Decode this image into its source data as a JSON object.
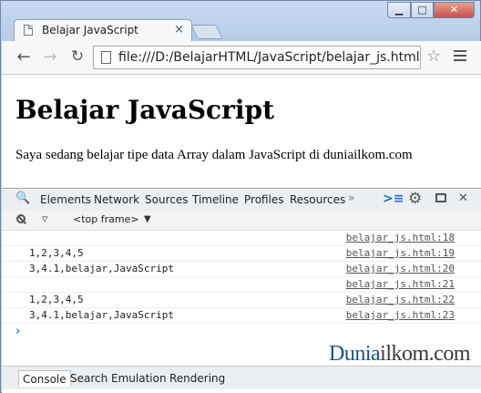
{
  "window": {
    "tab_title": "Belajar JavaScript",
    "tab_close": "×",
    "min_label": "▁",
    "max_label": "□",
    "close_label": "✕"
  },
  "toolbar": {
    "back": "←",
    "forward": "→",
    "reload": "↻",
    "url": "file:///D:/BelajarHTML/JavaScript/belajar_js.html",
    "star": "☆"
  },
  "page": {
    "heading": "Belajar JavaScript",
    "paragraph": "Saya sedang belajar tipe data Array dalam JavaScript di duniailkom.com"
  },
  "devtools": {
    "tabs": [
      "Elements",
      "Network",
      "Sources",
      "Timeline",
      "Profiles",
      "Resources"
    ],
    "more": "»",
    "frame_select": "<top frame>",
    "frame_arrow": "▼",
    "console_rows": [
      {
        "msg": "",
        "src": "belajar_js.html:18"
      },
      {
        "msg": "1,2,3,4,5",
        "src": "belajar_js.html:19"
      },
      {
        "msg": "3,4.1,belajar,JavaScript",
        "src": "belajar_js.html:20"
      },
      {
        "msg": "",
        "src": "belajar_js.html:21"
      },
      {
        "msg": "1,2,3,4,5",
        "src": "belajar_js.html:22"
      },
      {
        "msg": "3,4.1,belajar,JavaScript",
        "src": "belajar_js.html:23"
      }
    ],
    "prompt": "›",
    "drawer_tabs": [
      "Console",
      "Search",
      "Emulation",
      "Rendering"
    ]
  },
  "watermark": {
    "part1": "Dunia",
    "part2": "ilkom.com"
  },
  "colors": {
    "accent": "#367cf1",
    "brand_blue": "#1d4f8a",
    "close_red": "#c75050"
  }
}
